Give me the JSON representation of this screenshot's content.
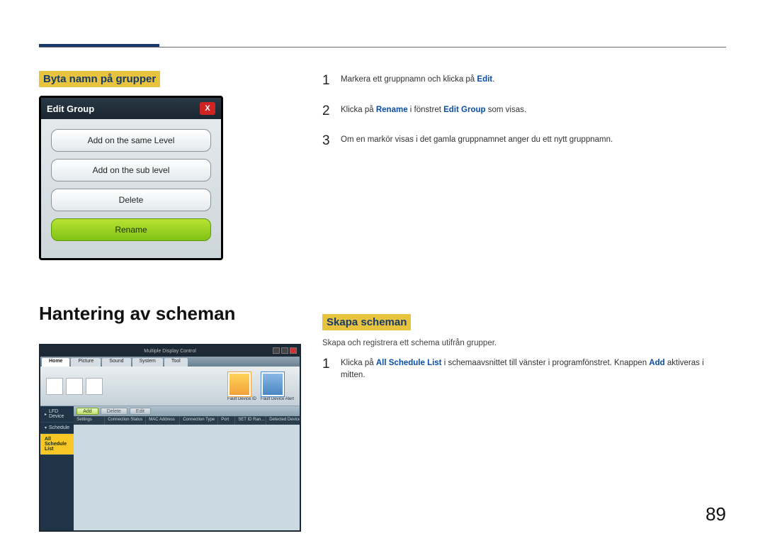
{
  "headings": {
    "rename_groups": "Byta namn på grupper",
    "schedule_mgmt": "Hantering av scheman",
    "create_schedules": "Skapa scheman"
  },
  "edit_group_dialog": {
    "title": "Edit Group",
    "close_glyph": "X",
    "buttons": {
      "same_level": "Add on the same Level",
      "sub_level": "Add on the sub level",
      "delete": "Delete",
      "rename": "Rename"
    }
  },
  "rename_steps": {
    "s1_pre": "Markera ett gruppnamn och klicka på ",
    "s1_kw": "Edit",
    "s1_post": ".",
    "s2_pre": "Klicka på ",
    "s2_kw1": "Rename",
    "s2_mid": " i fönstret ",
    "s2_kw2": "Edit Group",
    "s2_post": " som visas.",
    "s3": "Om en markör visas i det gamla gruppnamnet anger du ett nytt gruppnamn."
  },
  "create_schedule": {
    "intro": "Skapa och registrera ett schema utifrån grupper.",
    "s1_pre": "Klicka på ",
    "s1_kw1": "All Schedule List",
    "s1_mid": " i schemaavsnittet till vänster i programfönstret. Knappen ",
    "s1_kw2": "Add",
    "s1_post": " aktiveras i mitten."
  },
  "mdc": {
    "title": "Multiple Display Control",
    "tabs": [
      "Home",
      "Picture",
      "Sound",
      "System",
      "Tool"
    ],
    "ribbon": {
      "fault_id": "Fault Device ID",
      "fault_alert": "Fault Device Alert"
    },
    "sidebar": {
      "lfd_device": "LFD Device",
      "schedule": "Schedule",
      "all_schedule_list": "All Schedule List"
    },
    "toolbar": {
      "add": "Add",
      "delete": "Delete",
      "edit": "Edit"
    },
    "columns": [
      "Settings",
      "Connection Status",
      "MAC Address",
      "Connection Type",
      "Port",
      "SET ID Ran…",
      "Detected Devices"
    ]
  },
  "nums": {
    "n1": "1",
    "n2": "2",
    "n3": "3"
  },
  "page_number": "89"
}
